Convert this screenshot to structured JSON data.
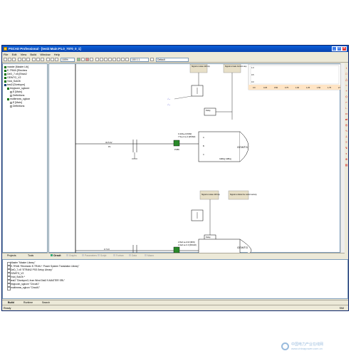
{
  "window": {
    "title": "PSCAD Professional - [test2:Main:P1.0_7070_0_1]"
  },
  "menu": [
    "File",
    "Edit",
    "View",
    "Build",
    "Window",
    "Help"
  ],
  "toolbar": {
    "zoom": "100%",
    "pen": "100 1 1",
    "unit": "Default"
  },
  "tree": {
    "items": [
      {
        "label": "master [Master Lib]",
        "icon": "green"
      },
      {
        "label": "E-TRAN [Electrea",
        "icon": "green"
      },
      {
        "label": "DeD_7.x5 [Etran2",
        "icon": "green"
      },
      {
        "label": "GEWTG_V2",
        "icon": "green"
      },
      {
        "label": "Vsid_Sub2b",
        "icon": "green"
      },
      {
        "label": "test2 [Divelopm]",
        "icon": "blue"
      },
      {
        "label": "tmpjcunn_sglconr",
        "icon": "green"
      },
      {
        "label": "E [Main]",
        "icon": "white"
      },
      {
        "label": "Definitions",
        "icon": "white"
      },
      {
        "label": "multirneav_sglcon",
        "icon": "green"
      },
      {
        "label": "E [Main]",
        "icon": "white"
      },
      {
        "label": "Definitions",
        "icon": "white"
      }
    ],
    "tabs": [
      "Projects",
      "Tools"
    ]
  },
  "schematic": {
    "bus1": {
      "kv": "34.5 kV",
      "label": "P1",
      "flow": "0.423e+0 [MW]",
      "flow2": "7.5e+1 le-2 [MVAR]",
      "tag": "PCB5"
    },
    "bus2": {
      "kv": "0.7 kV",
      "label": "P1",
      "flow": "2.8e0 se-010 [MW]",
      "flow2": "4.3e0 se 0.0 [MVAR]",
      "tag": "PCB6"
    },
    "gen_label": "GEWTG",
    "gen_sub": "C&Blog C&Blog",
    "signal1": "Signal to relate 418 trip",
    "signal2": "Signal to trade Control step",
    "signal3": "Signal to relate 418 trip",
    "signal4": "Signal to divide the control activity",
    "delay": "Delay",
    "plot_x_ticks": [
      "0.0",
      "0.25",
      "0.50",
      "0.75",
      "1.00",
      "1.25",
      "1.50",
      "1.75",
      "2.00"
    ],
    "plot_y_ticks": [
      "1.0",
      "0.5",
      "0.0"
    ]
  },
  "doc_tabs": [
    "Circuit",
    "Graphs",
    "Parameters",
    "Script",
    "Fortran",
    "Data",
    "Macro"
  ],
  "output": {
    "lines": [
      "Master \"Master Library\"",
      "E-TRAN \"Electranix E-TRAN + Power System Translation Library\"",
      "DeD_7.x5 \"ETRAN2 PSS Setup Library\"",
      "GEWTG_V2",
      "Vsid_Sub2b *",
      "test2 \"Divelopm3, from Wind Dist3 9-MASTER SRL\"",
      "tmpjcunn_sglconr \"Circuit1\"",
      "multirneav_sglcon \"Circuit1\""
    ],
    "tabs": [
      "Build",
      "Runtime",
      "Search"
    ]
  },
  "status": {
    "left": "Ready",
    "right": "SIM"
  },
  "watermark": {
    "line1": "中国电力产业在线网",
    "line2": "www.chinapower.com.cn"
  }
}
